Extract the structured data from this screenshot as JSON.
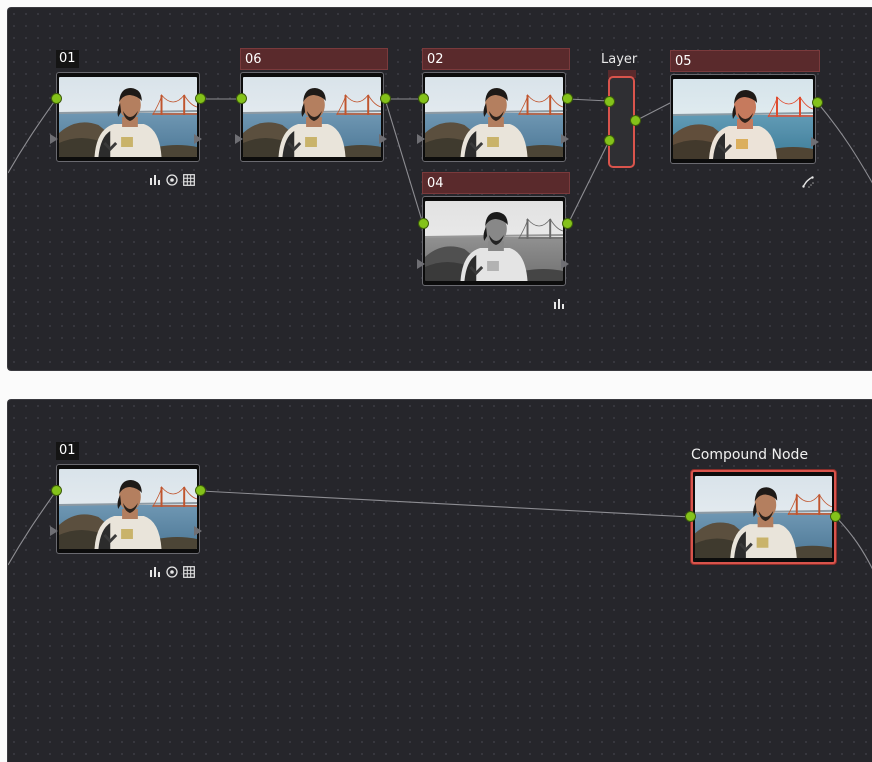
{
  "top_panel": {
    "nodes": [
      {
        "id": "01",
        "label": "01",
        "style": "plain",
        "look": "color",
        "badges": [
          "bar-chart-icon",
          "circle-dot-icon",
          "grid-icon"
        ]
      },
      {
        "id": "06",
        "label": "06",
        "style": "red",
        "look": "color",
        "badges": []
      },
      {
        "id": "02",
        "label": "02",
        "style": "red",
        "look": "color",
        "badges": []
      },
      {
        "id": "04",
        "label": "04",
        "style": "red",
        "look": "bw",
        "badges": [
          "bar-chart-icon"
        ]
      },
      {
        "id": "05",
        "label": "05",
        "style": "red",
        "look": "warm",
        "badges": [
          "curve-icon"
        ]
      }
    ],
    "layer_mixer": {
      "title": "Layer"
    }
  },
  "bottom_panel": {
    "nodes": [
      {
        "id": "01",
        "label": "01",
        "style": "plain",
        "look": "color",
        "badges": [
          "bar-chart-icon",
          "circle-dot-icon",
          "grid-icon"
        ]
      }
    ],
    "compound_node": {
      "title": "Compound Node",
      "look": "color"
    }
  },
  "colors": {
    "panel_bg": "#26262b",
    "port_green": "#84c21a",
    "label_red": "#5a2a2c",
    "selection_red": "#d9544c",
    "connector": "#8d8d92"
  }
}
